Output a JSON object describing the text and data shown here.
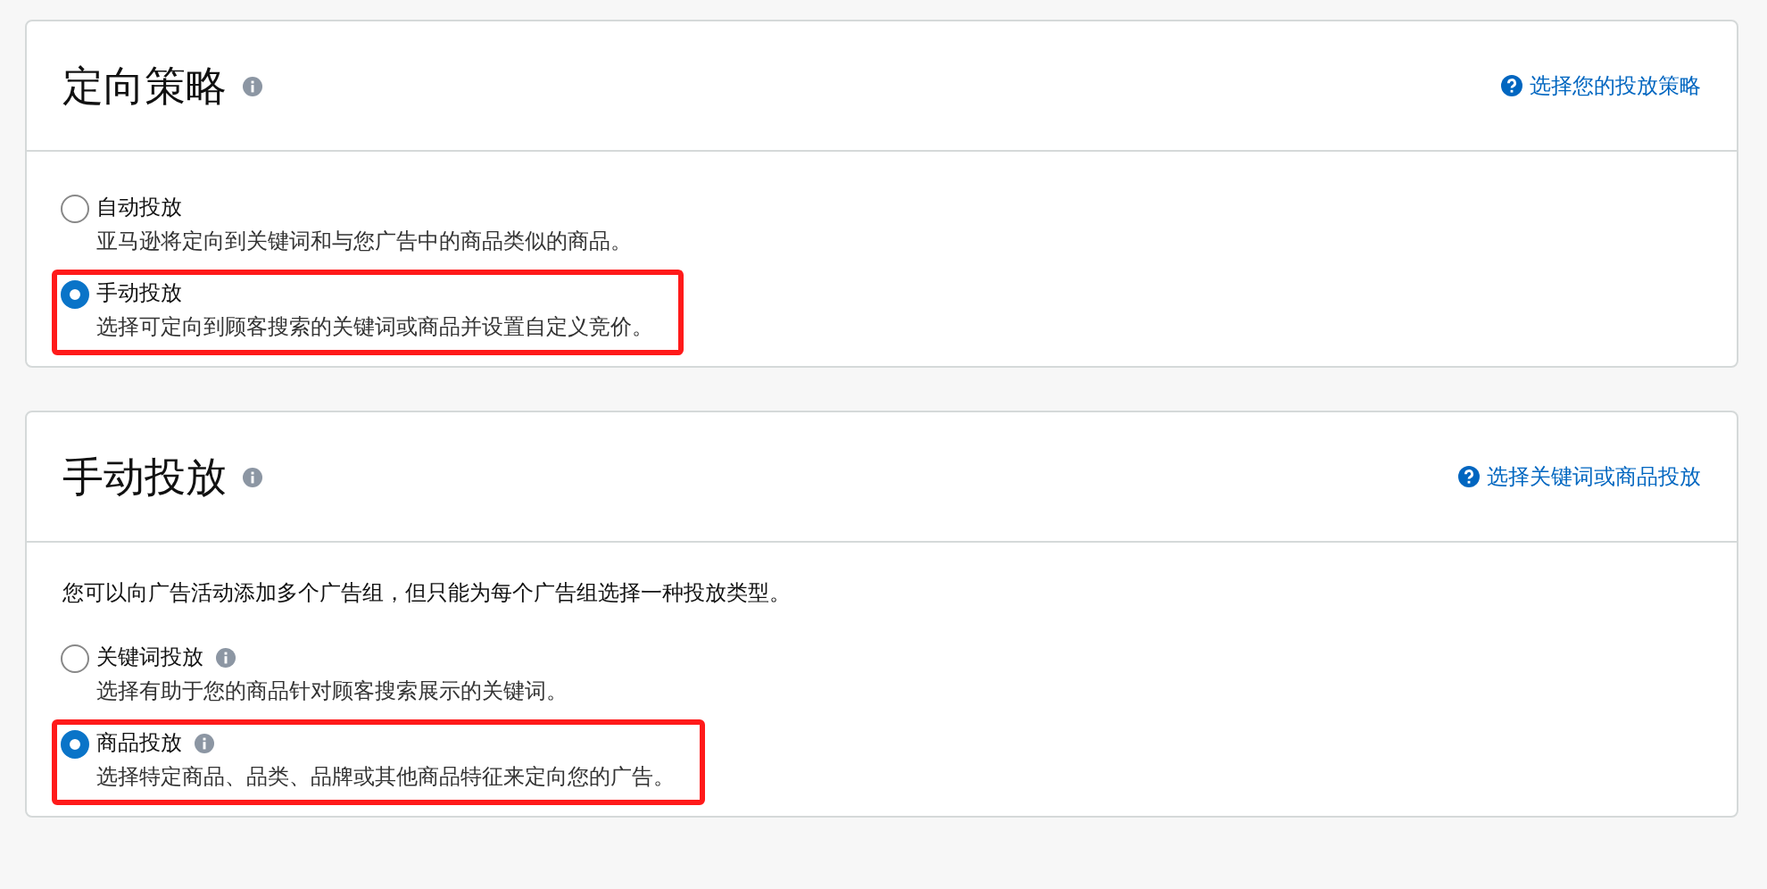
{
  "sections": [
    {
      "title": "定向策略",
      "help_link": "选择您的投放策略",
      "options": [
        {
          "label": "自动投放",
          "description": "亚马逊将定向到关键词和与您广告中的商品类似的商品。",
          "selected": false,
          "info": false,
          "highlighted": false
        },
        {
          "label": "手动投放",
          "description": "选择可定向到顾客搜索的关键词或商品并设置自定义竞价。",
          "selected": true,
          "info": false,
          "highlighted": true
        }
      ]
    },
    {
      "title": "手动投放",
      "help_link": "选择关键词或商品投放",
      "intro": "您可以向广告活动添加多个广告组，但只能为每个广告组选择一种投放类型。",
      "options": [
        {
          "label": "关键词投放",
          "description": "选择有助于您的商品针对顾客搜索展示的关键词。",
          "selected": false,
          "info": true,
          "highlighted": false
        },
        {
          "label": "商品投放",
          "description": "选择特定商品、品类、品牌或其他商品特征来定向您的广告。",
          "selected": true,
          "info": true,
          "highlighted": true
        }
      ]
    }
  ]
}
